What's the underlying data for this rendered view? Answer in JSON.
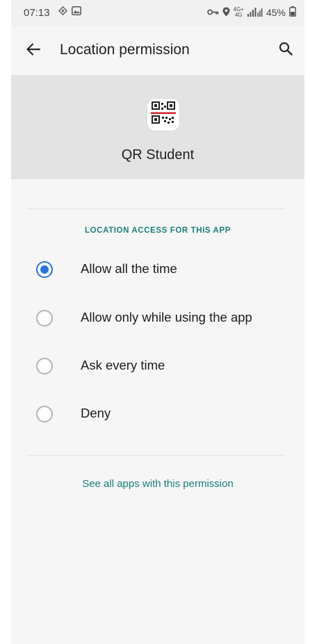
{
  "status_bar": {
    "time": "07:13",
    "network_top": "4G+",
    "network_bottom": "4G",
    "battery": "45%"
  },
  "app_bar": {
    "title": "Location permission",
    "back_icon": "arrow-back-icon",
    "search_icon": "search-icon"
  },
  "app": {
    "name": "QR Student",
    "icon": "qr-code-icon"
  },
  "section": {
    "title": "LOCATION ACCESS FOR THIS APP"
  },
  "options": [
    {
      "label": "Allow all the time",
      "selected": true
    },
    {
      "label": "Allow only while using the app",
      "selected": false
    },
    {
      "label": "Ask every time",
      "selected": false
    },
    {
      "label": "Deny",
      "selected": false
    }
  ],
  "footer_link": "See all apps with this permission",
  "colors": {
    "accent": "#2c73d6",
    "link": "#1a7f78",
    "header_band": "#e3e3e3",
    "background": "#f6f6f6"
  }
}
